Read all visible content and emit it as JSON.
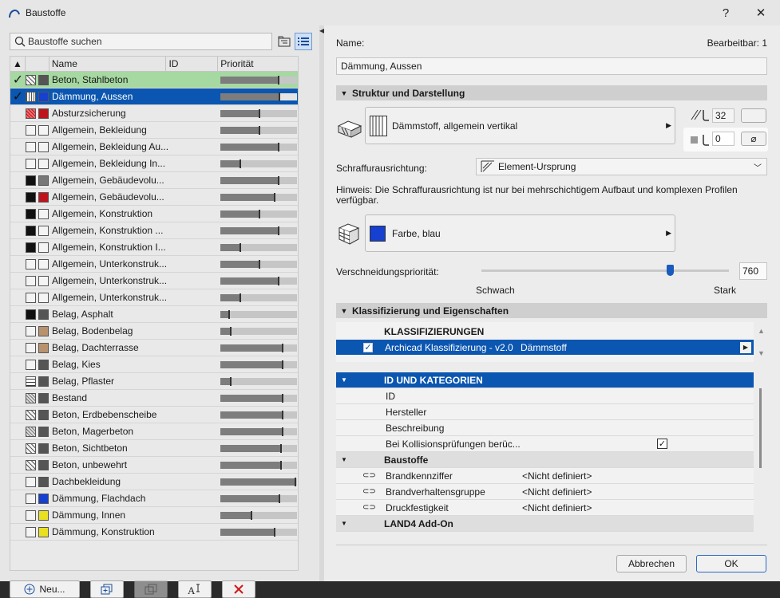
{
  "window": {
    "title": "Baustoffe",
    "help": "?",
    "close": "✕"
  },
  "search": {
    "placeholder": "Baustoffe suchen"
  },
  "list": {
    "columns": [
      "Name",
      "ID",
      "Priorität"
    ],
    "rows": [
      {
        "name": "Beton, Stahlbeton",
        "check": "✓",
        "p": 0.75,
        "s1": "x",
        "s2": "#555555",
        "state": "green"
      },
      {
        "name": "Dämmung, Aussen",
        "check": "✓",
        "p": 0.76,
        "s1": "v",
        "s2": "#1540d0",
        "state": "blue"
      },
      {
        "name": "Absturzsicherung",
        "check": "",
        "p": 0.5,
        "s1": "r",
        "s2": "#c0141c",
        "state": ""
      },
      {
        "name": "Allgemein, Bekleidung",
        "check": "",
        "p": 0.5,
        "s1": "",
        "s2": "#f4f4f4",
        "state": ""
      },
      {
        "name": "Allgemein, Bekleidung Au...",
        "check": "",
        "p": 0.75,
        "s1": "",
        "s2": "#f4f4f4",
        "state": ""
      },
      {
        "name": "Allgemein, Bekleidung In...",
        "check": "",
        "p": 0.25,
        "s1": "",
        "s2": "#f4f4f4",
        "state": ""
      },
      {
        "name": "Allgemein, Gebäudevolu...",
        "check": "",
        "p": 0.75,
        "s1": "k",
        "s2": "#777777",
        "state": ""
      },
      {
        "name": "Allgemein, Gebäudevolu...",
        "check": "",
        "p": 0.7,
        "s1": "k",
        "s2": "#c0141c",
        "state": ""
      },
      {
        "name": "Allgemein, Konstruktion",
        "check": "",
        "p": 0.5,
        "s1": "k",
        "s2": "#f4f4f4",
        "state": ""
      },
      {
        "name": "Allgemein, Konstruktion ...",
        "check": "",
        "p": 0.75,
        "s1": "k",
        "s2": "#f4f4f4",
        "state": ""
      },
      {
        "name": "Allgemein, Konstruktion I...",
        "check": "",
        "p": 0.25,
        "s1": "k",
        "s2": "#f4f4f4",
        "state": ""
      },
      {
        "name": "Allgemein, Unterkonstruk...",
        "check": "",
        "p": 0.5,
        "s1": "",
        "s2": "#f4f4f4",
        "state": ""
      },
      {
        "name": "Allgemein, Unterkonstruk...",
        "check": "",
        "p": 0.75,
        "s1": "",
        "s2": "#f4f4f4",
        "state": ""
      },
      {
        "name": "Allgemein, Unterkonstruk...",
        "check": "",
        "p": 0.25,
        "s1": "",
        "s2": "#f4f4f4",
        "state": ""
      },
      {
        "name": "Belag, Asphalt",
        "check": "",
        "p": 0.1,
        "s1": "k",
        "s2": "#555555",
        "state": ""
      },
      {
        "name": "Belag, Bodenbelag",
        "check": "",
        "p": 0.12,
        "s1": "",
        "s2": "#b8926e",
        "state": ""
      },
      {
        "name": "Belag, Dachterrasse",
        "check": "",
        "p": 0.8,
        "s1": "",
        "s2": "#b8926e",
        "state": ""
      },
      {
        "name": "Belag, Kies",
        "check": "",
        "p": 0.8,
        "s1": "",
        "s2": "#555555",
        "state": ""
      },
      {
        "name": "Belag, Pflaster",
        "check": "",
        "p": 0.12,
        "s1": "g",
        "s2": "#555555",
        "state": ""
      },
      {
        "name": "Bestand",
        "check": "",
        "p": 0.8,
        "s1": "d",
        "s2": "#555555",
        "state": ""
      },
      {
        "name": "Beton, Erdbebenscheibe",
        "check": "",
        "p": 0.8,
        "s1": "x",
        "s2": "#555555",
        "state": ""
      },
      {
        "name": "Beton, Magerbeton",
        "check": "",
        "p": 0.8,
        "s1": "d",
        "s2": "#555555",
        "state": ""
      },
      {
        "name": "Beton, Sichtbeton",
        "check": "",
        "p": 0.78,
        "s1": "x",
        "s2": "#555555",
        "state": ""
      },
      {
        "name": "Beton, unbewehrt",
        "check": "",
        "p": 0.78,
        "s1": "x",
        "s2": "#555555",
        "state": ""
      },
      {
        "name": "Dachbekleidung",
        "check": "",
        "p": 0.97,
        "s1": "",
        "s2": "#555555",
        "state": ""
      },
      {
        "name": "Dämmung, Flachdach",
        "check": "",
        "p": 0.76,
        "s1": "",
        "s2": "#1540d0",
        "state": ""
      },
      {
        "name": "Dämmung, Innen",
        "check": "",
        "p": 0.4,
        "s1": "",
        "s2": "#e8e020",
        "state": ""
      },
      {
        "name": "Dämmung, Konstruktion",
        "check": "",
        "p": 0.7,
        "s1": "",
        "s2": "#e8e020",
        "state": ""
      }
    ]
  },
  "bottom": {
    "new_label": "Neu..."
  },
  "detail": {
    "name_label": "Name:",
    "editable": "Bearbeitbar: 1",
    "name_value": "Dämmung, Aussen",
    "section1": "Struktur und Darstellung",
    "fill_name": "Dämmstoff, allgemein vertikal",
    "pen_value": "32",
    "bg_pen_value": "0",
    "hatch_orient_label": "Schraffurausrichtung:",
    "hatch_orient_value": "Element-Ursprung",
    "hint": "Hinweis: Die Schraffurausrichtung ist nur bei mehrschichtigem Aufbaut und komplexen Profilen verfügbar.",
    "surface": "Farbe, blau",
    "surface_color": "#1540d0",
    "priority_label": "Verschneidungspriorität:",
    "priority_value": "760",
    "priority_fraction": 0.76,
    "weak": "Schwach",
    "strong": "Stark",
    "section2": "Klassifizierung und Eigenschaften",
    "class_header": "KLASSIFIZIERUNGEN",
    "class_system": "Archicad Klassifizierung - v2.0",
    "class_value": "Dämmstoff",
    "id_header": "ID UND KATEGORIEN",
    "id": "ID",
    "manufacturer": "Hersteller",
    "description": "Beschreibung",
    "collision": "Bei Kollisionsprüfungen berüc...",
    "group_baustoffe": "Baustoffe",
    "brand": "Brandkennziffer",
    "brand_group": "Brandverhaltensgruppe",
    "strength": "Druckfestigkeit",
    "undefined": "<Nicht definiert>",
    "land4": "LAND4 Add-On"
  },
  "footer": {
    "cancel": "Abbrechen",
    "ok": "OK"
  }
}
